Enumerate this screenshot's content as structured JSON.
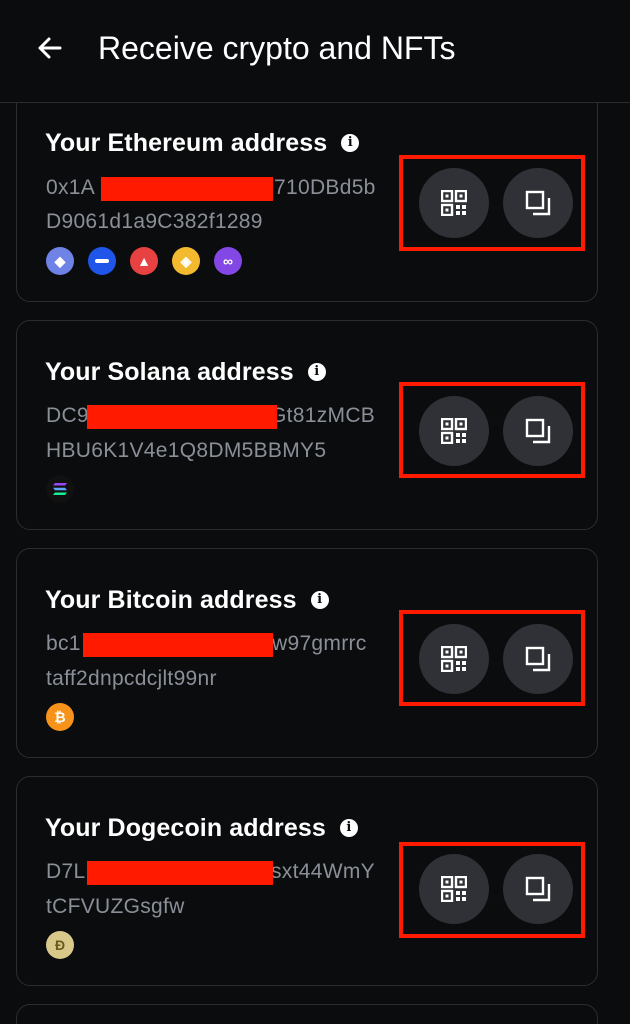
{
  "header": {
    "title": "Receive crypto and NFTs",
    "back_icon": "arrow-left-icon"
  },
  "cards": [
    {
      "title": "Your Ethereum address",
      "address_line1_start": "0x1A",
      "address_line1_end": "710DBd5b",
      "address_line2": "D9061d1a9C382f1289",
      "chains": [
        {
          "icon": "ethereum-icon",
          "color": "#6f82e6",
          "glyph": "◆"
        },
        {
          "icon": "base-icon",
          "color": "#1f55e8",
          "glyph": "—"
        },
        {
          "icon": "avalanche-icon",
          "color": "#e84142",
          "glyph": "▲"
        },
        {
          "icon": "bnb-icon",
          "color": "#f3ba2f",
          "glyph": "◈"
        },
        {
          "icon": "polygon-icon",
          "color": "#8247e5",
          "glyph": "∞"
        }
      ]
    },
    {
      "title": "Your Solana address",
      "address_line1_start": "DC9",
      "address_line1_end": "Gt81zMCB",
      "address_line2": "HBU6K1V4e1Q8DM5BBMY5",
      "chains": [
        {
          "icon": "solana-icon",
          "color": "#111111",
          "glyph": "≡"
        }
      ]
    },
    {
      "title": "Your Bitcoin address",
      "address_line1_start": "bc1",
      "address_line1_end": "w97gmrrc",
      "address_line2": "taff2dnpcdcjlt99nr",
      "chains": [
        {
          "icon": "bitcoin-icon",
          "color": "#f7931a",
          "glyph": "₿"
        }
      ]
    },
    {
      "title": "Your Dogecoin address",
      "address_line1_start": "D7L",
      "address_line1_end": "sxt44WmY",
      "address_line2": "tCFVUZGsgfw",
      "chains": [
        {
          "icon": "dogecoin-icon",
          "color": "#c2a633",
          "glyph": "Ð"
        }
      ]
    }
  ],
  "colors": {
    "background": "#0b0c0e",
    "card_border": "#2b2d31",
    "button_bg": "#2f3136",
    "redaction": "#ff1a00",
    "address_text": "#8a8f98"
  }
}
